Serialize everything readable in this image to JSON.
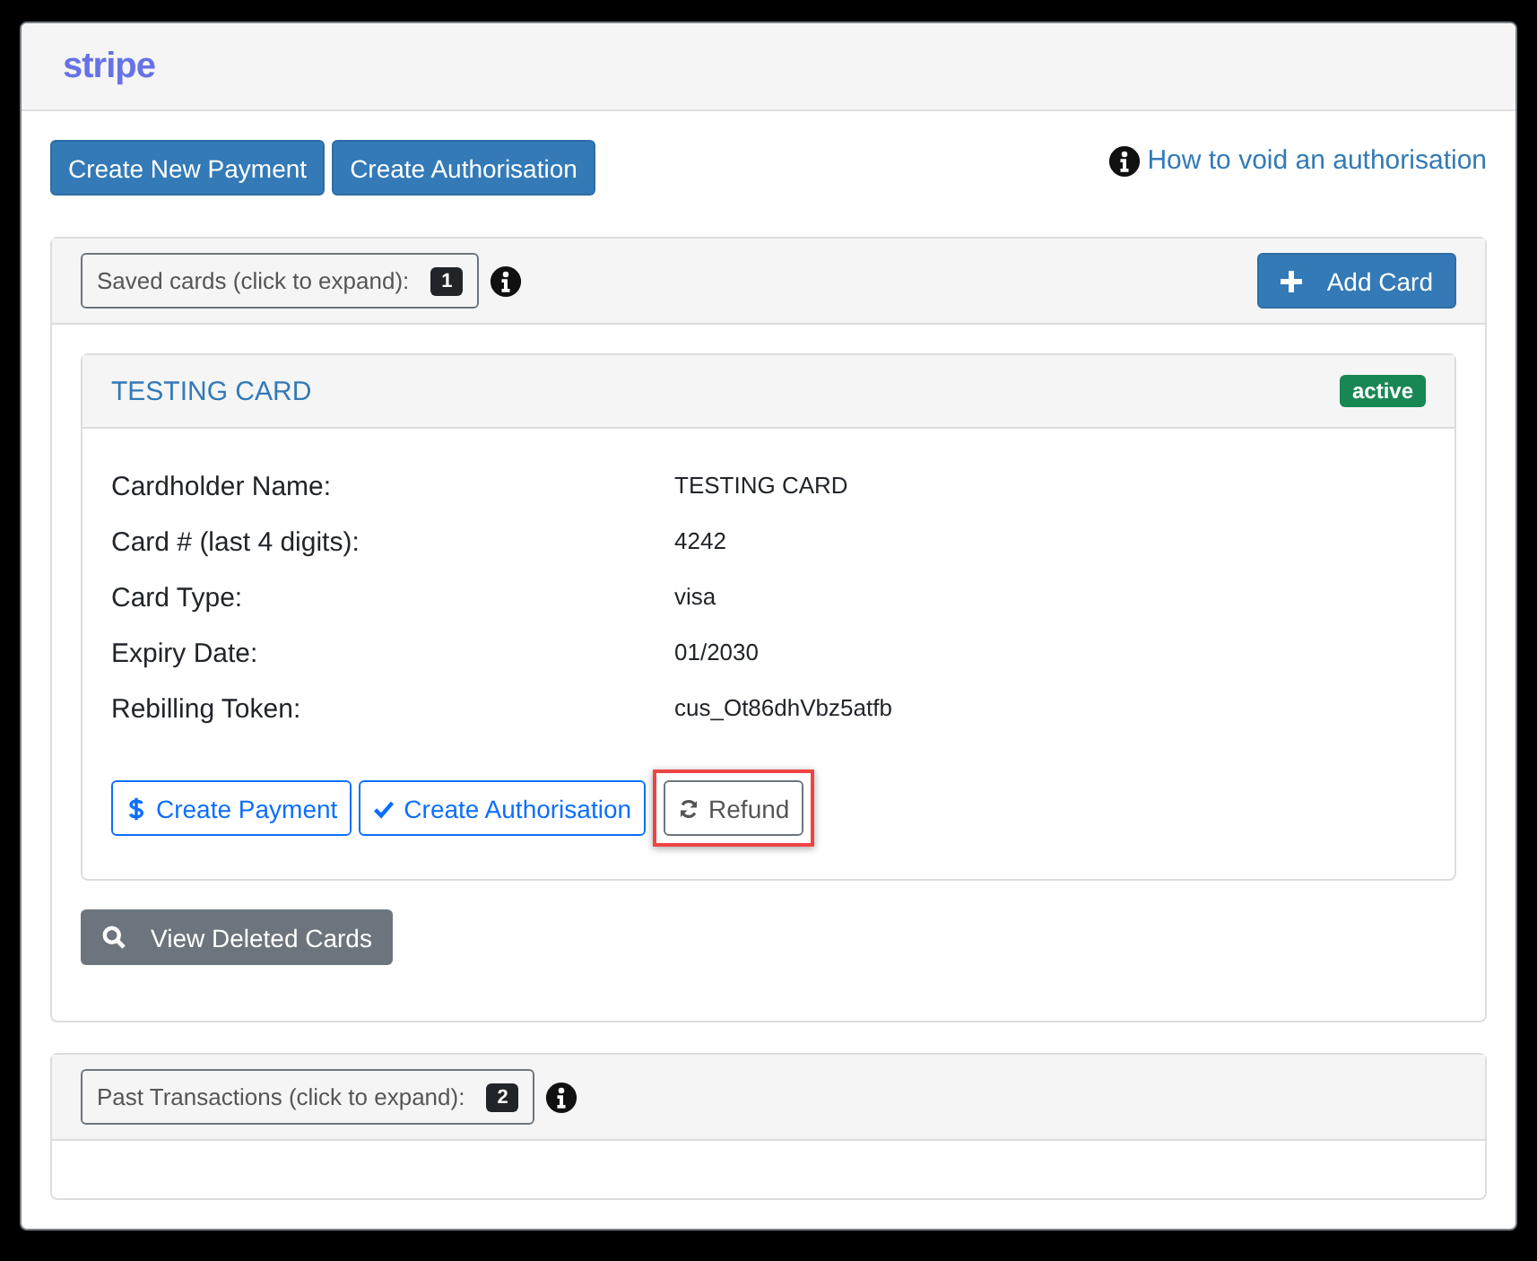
{
  "logo": "stripe",
  "top_buttons": [
    "Create New Payment",
    "Create Authorisation"
  ],
  "help_link": "How to void an authorisation",
  "saved_cards": {
    "label": "Saved cards (click to expand):",
    "count": "1",
    "add_button": "Add Card",
    "cards": [
      {
        "title": "TESTING CARD",
        "status": "active",
        "fields": [
          {
            "label": "Cardholder Name:",
            "value": "TESTING CARD"
          },
          {
            "label": "Card # (last 4 digits):",
            "value": "4242"
          },
          {
            "label": "Card Type:",
            "value": "visa"
          },
          {
            "label": "Expiry Date:",
            "value": "01/2030"
          },
          {
            "label": "Rebilling Token:",
            "value": "cus_Ot86dhVbz5atfb"
          }
        ],
        "actions": [
          {
            "label": "Create Payment",
            "kind": "dollar",
            "highlighted": false
          },
          {
            "label": "Create Authorisation",
            "kind": "check",
            "highlighted": false
          },
          {
            "label": "Refund",
            "kind": "refresh",
            "highlighted": true
          }
        ]
      }
    ],
    "deleted_button": "View Deleted Cards"
  },
  "past_transactions": {
    "label": "Past Transactions (click to expand):",
    "count": "2"
  }
}
